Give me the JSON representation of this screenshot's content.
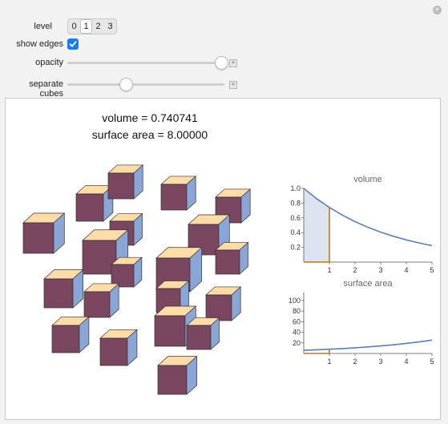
{
  "controls": {
    "level_label": "level",
    "level_options": [
      "0",
      "1",
      "2",
      "3"
    ],
    "level_selected": "1",
    "show_edges_label": "show edges",
    "show_edges_checked": true,
    "opacity_label": "opacity",
    "opacity_value": 1.0,
    "separate_cubes_label": "separate cubes",
    "separate_cubes_value": 0.37,
    "plus_symbol": "+"
  },
  "stats": {
    "volume_text": "volume = 0.740741",
    "surface_area_text": "surface area = 8.00000"
  },
  "colors": {
    "cube_top": "#ffdca8",
    "cube_front": "#7a4660",
    "cube_side": "#8aa6d6",
    "curve": "#5b7fb5",
    "marker": "#b97a1e",
    "fill": "#dde4f0"
  },
  "chart_data": [
    {
      "type": "area",
      "title": "volume",
      "x": [
        0,
        0.5,
        1,
        1.5,
        2,
        2.5,
        3,
        3.5,
        4,
        4.5,
        5
      ],
      "y": [
        1,
        0.8607,
        0.7407,
        0.6376,
        0.5487,
        0.4723,
        0.4064,
        0.3498,
        0.3011,
        0.2592,
        0.2231
      ],
      "xlim": [
        0,
        5
      ],
      "ylim": [
        0,
        1
      ],
      "xticks": [
        "1",
        "2",
        "3",
        "4",
        "5"
      ],
      "yticks": [
        "0.2",
        "0.4",
        "0.6",
        "0.8",
        "1.0"
      ],
      "marker_x": 1,
      "marker_y": 0.740741
    },
    {
      "type": "line",
      "title": "surface area",
      "x": [
        0,
        0.5,
        1,
        1.5,
        2,
        2.5,
        3,
        3.5,
        4,
        4.5,
        5
      ],
      "y": [
        6,
        6.93,
        8,
        9.24,
        10.67,
        12.32,
        14.22,
        16.42,
        18.96,
        21.89,
        25.28
      ],
      "xlim": [
        0,
        5
      ],
      "ylim": [
        0,
        115
      ],
      "xticks": [
        "1",
        "2",
        "3",
        "4",
        "5"
      ],
      "yticks": [
        "20",
        "40",
        "60",
        "80",
        "100"
      ],
      "marker_x": 1,
      "marker_y": 8
    }
  ]
}
